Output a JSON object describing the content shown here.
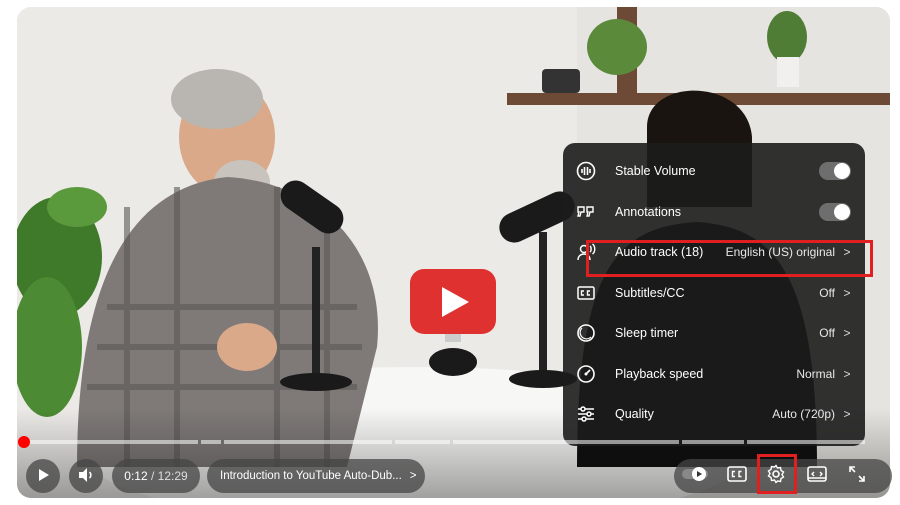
{
  "player": {
    "time_current": "0:12",
    "time_separator": " / ",
    "time_total": "12:29",
    "chapter_title": "Introduction to YouTube Auto-Dub...",
    "chapter_chevron": ">",
    "progress_fraction": 0.01,
    "accent_color": "#ff0000"
  },
  "settings_menu": {
    "items": [
      {
        "icon": "stable-volume-icon",
        "label": "Stable Volume",
        "type": "toggle"
      },
      {
        "icon": "annotations-icon",
        "label": "Annotations",
        "type": "toggle"
      },
      {
        "icon": "audio-track-icon",
        "label": "Audio track (18)",
        "value": "English (US) original",
        "type": "submenu"
      },
      {
        "icon": "subtitles-icon",
        "label": "Subtitles/CC",
        "value": "Off",
        "type": "submenu"
      },
      {
        "icon": "sleep-timer-icon",
        "label": "Sleep timer",
        "value": "Off",
        "type": "submenu"
      },
      {
        "icon": "playback-speed-icon",
        "label": "Playback speed",
        "value": "Normal",
        "type": "submenu"
      },
      {
        "icon": "quality-icon",
        "label": "Quality",
        "value": "Auto (720p)",
        "type": "submenu"
      }
    ],
    "chevron": ">"
  },
  "controls": {
    "play": "play-icon",
    "volume": "volume-icon",
    "autoplay": "autoplay-toggle-icon",
    "subtitles": "cc-icon",
    "settings": "gear-icon",
    "theater": "theater-mode-icon",
    "fullscreen": "fullscreen-icon"
  },
  "highlight_color": "#e02020"
}
